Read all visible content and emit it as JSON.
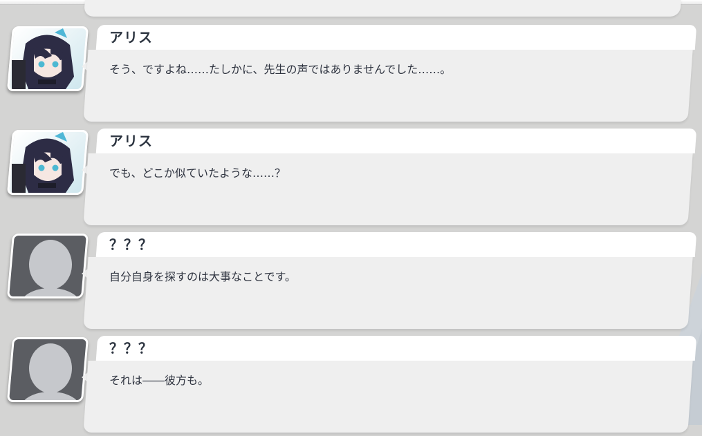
{
  "log": [
    {
      "speaker": "アリス",
      "avatar": "aris-portrait",
      "text": "そう、ですよね……たしかに、先生の声ではありませんでした……。"
    },
    {
      "speaker": "アリス",
      "avatar": "aris-portrait",
      "text": "でも、どこか似ていたような……？"
    },
    {
      "speaker": "？？？",
      "avatar": "unknown-silhouette",
      "text": "自分自身を探すのは大事なことです。"
    },
    {
      "speaker": "？？？",
      "avatar": "unknown-silhouette",
      "text": "それは――彼方も。"
    }
  ],
  "colors": {
    "background": "#d4d4d3",
    "name_tab": "#ffffff",
    "message_box": "#efefef",
    "text": "#2f3440",
    "unknown_avatar": "#5b5d62"
  }
}
